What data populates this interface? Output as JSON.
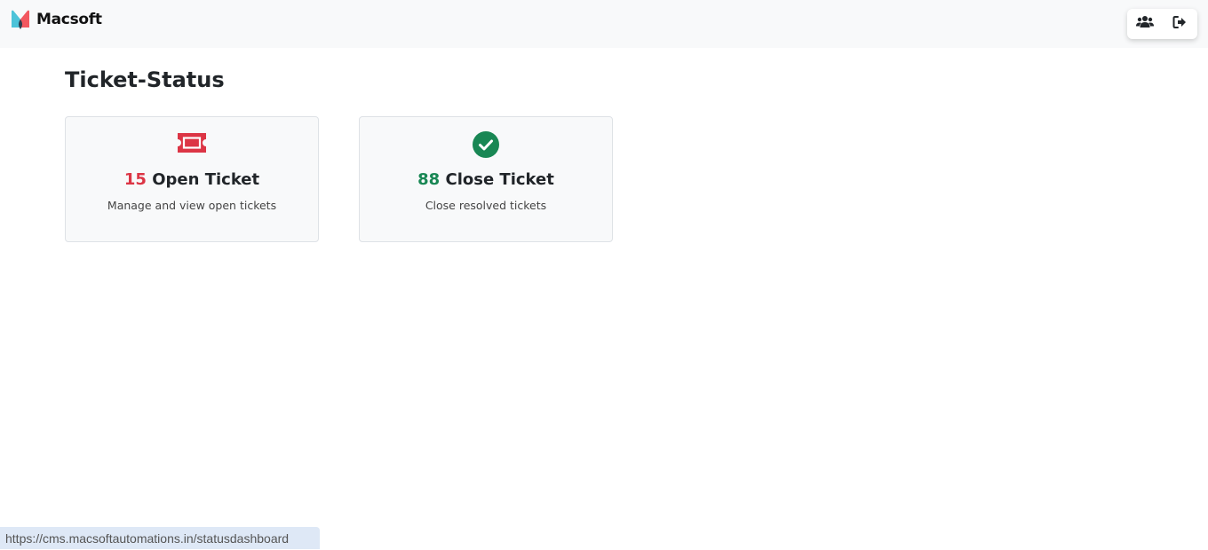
{
  "brand": {
    "name": "Macsoft",
    "logo_icon": "macsoft-logo-icon"
  },
  "nav": {
    "actions": [
      {
        "icon": "users-icon"
      },
      {
        "icon": "sign-out-icon"
      }
    ]
  },
  "page": {
    "title": "Ticket-Status"
  },
  "cards": {
    "open": {
      "icon": "ticket-icon",
      "count": "15",
      "label": "Open Ticket",
      "description": "Manage and view open tickets",
      "accent": "#dc3545"
    },
    "close": {
      "icon": "check-circle-icon",
      "count": "88",
      "label": "Close Ticket",
      "description": "Close resolved tickets",
      "accent": "#198754"
    }
  },
  "status_bar": {
    "url": "https://cms.macsoftautomations.in/statusdashboard"
  }
}
